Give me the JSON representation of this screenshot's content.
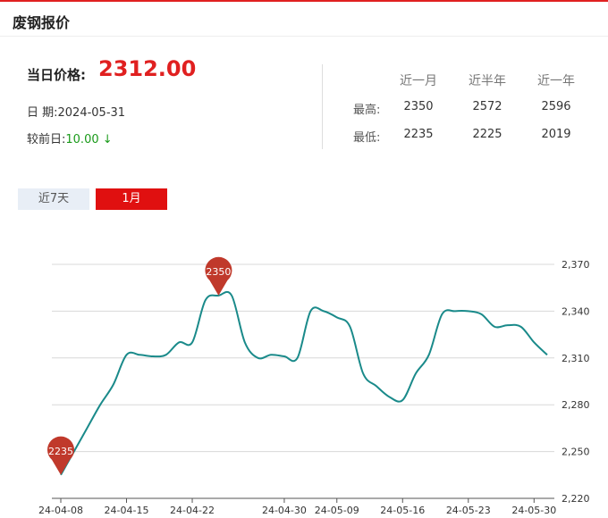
{
  "header": {
    "title": "废钢报价"
  },
  "summary": {
    "price_label": "当日价格:",
    "price": "2312.00",
    "date_label": "日  期:",
    "date": "2024-05-31",
    "change_label": "较前日:",
    "change": "10.00 ↓"
  },
  "stats": {
    "columns": [
      "近一月",
      "近半年",
      "近一年"
    ],
    "rows": [
      {
        "label": "最高:",
        "values": [
          "2350",
          "2572",
          "2596"
        ]
      },
      {
        "label": "最低:",
        "values": [
          "2235",
          "2225",
          "2019"
        ]
      }
    ]
  },
  "tabs": [
    {
      "label": "近7天",
      "active": false
    },
    {
      "label": "1月",
      "active": true
    }
  ],
  "colors": {
    "accent": "#e02020",
    "line": "#1a8a8a",
    "pin": "#c0392b",
    "down": "#1a9a1a"
  },
  "chart_data": {
    "type": "line",
    "x": [
      "24-04-08",
      "24-04-09",
      "24-04-10",
      "24-04-11",
      "24-04-12",
      "24-04-15",
      "24-04-16",
      "24-04-17",
      "24-04-18",
      "24-04-19",
      "24-04-22",
      "24-04-23",
      "24-04-24",
      "24-04-25",
      "24-04-26",
      "24-04-28",
      "24-04-29",
      "24-04-30",
      "24-05-06",
      "24-05-07",
      "24-05-08",
      "24-05-09",
      "24-05-10",
      "24-05-13",
      "24-05-14",
      "24-05-15",
      "24-05-16",
      "24-05-17",
      "24-05-20",
      "24-05-21",
      "24-05-22",
      "24-05-23",
      "24-05-24",
      "24-05-27",
      "24-05-28",
      "24-05-29",
      "24-05-30",
      "24-05-31"
    ],
    "values": [
      2235,
      2250,
      2265,
      2280,
      2293,
      2312,
      2312,
      2311,
      2312,
      2320,
      2320,
      2347,
      2350,
      2350,
      2320,
      2310,
      2312,
      2311,
      2310,
      2340,
      2340,
      2336,
      2330,
      2300,
      2292,
      2285,
      2283,
      2300,
      2312,
      2338,
      2340,
      2340,
      2338,
      2330,
      2331,
      2330,
      2320,
      2312
    ],
    "x_ticks": [
      "24-04-08",
      "24-04-15",
      "24-04-22",
      "24-04-30",
      "24-05-09",
      "24-05-16",
      "24-05-23",
      "24-05-30"
    ],
    "y_ticks": [
      "2,370",
      "2,340",
      "2,310",
      "2,280",
      "2,250",
      "2,220"
    ],
    "ylim": [
      2220,
      2370
    ],
    "markers": [
      {
        "label": "2350",
        "value": 2350,
        "kind": "max"
      },
      {
        "label": "2235",
        "value": 2235,
        "kind": "min"
      }
    ],
    "grid": true
  }
}
